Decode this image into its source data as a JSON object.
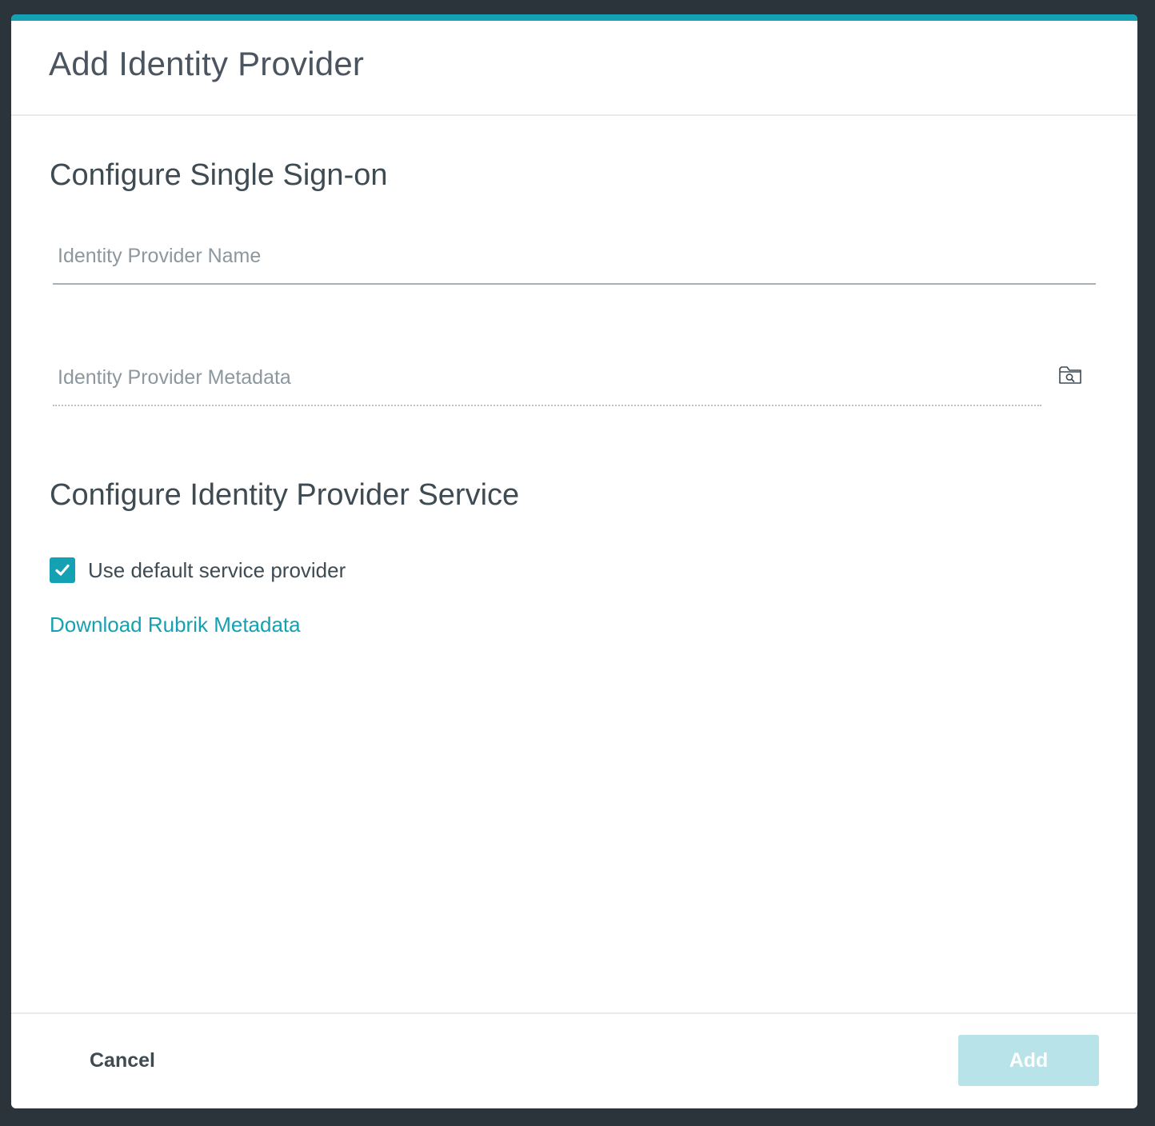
{
  "dialog": {
    "title": "Add Identity Provider",
    "accent_color": "#14a1b3"
  },
  "sso_section": {
    "heading": "Configure Single Sign-on",
    "name_field": {
      "value": "",
      "placeholder": "Identity Provider Name"
    },
    "metadata_field": {
      "value": "",
      "placeholder": "Identity Provider Metadata",
      "browse_icon": "folder-search-icon"
    }
  },
  "service_section": {
    "heading": "Configure Identity Provider Service",
    "use_default": {
      "checked": true,
      "label": "Use default service provider"
    },
    "download_link": "Download Rubrik Metadata"
  },
  "footer": {
    "cancel_label": "Cancel",
    "add_label": "Add",
    "add_disabled": true
  }
}
